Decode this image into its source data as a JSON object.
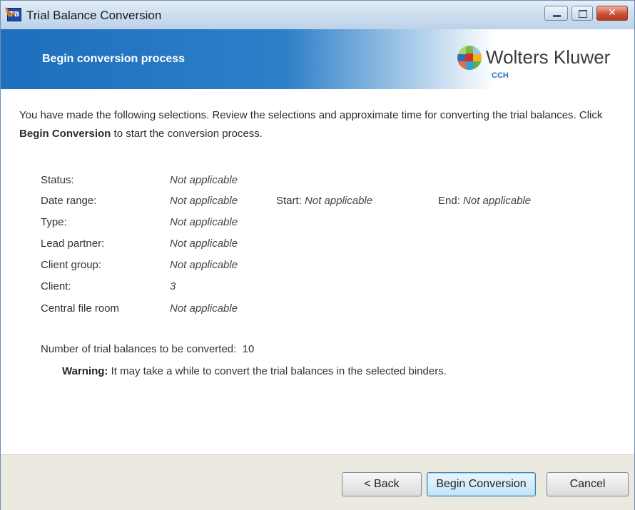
{
  "window": {
    "title": "Trial Balance Conversion",
    "app_icon_text": "TB",
    "close_glyph": "✕",
    "icons": [
      "minimize-icon",
      "maximize-icon",
      "close-icon"
    ]
  },
  "banner": {
    "title": "Begin conversion process",
    "logo_name": "Wolters Kluwer",
    "logo_sub": "CCH",
    "colors": {
      "banner_blue": "#1d6fbd",
      "logo_green": "#7bbd3a",
      "logo_red": "#d32f2f",
      "logo_blue": "#2a72b8",
      "logo_yellow": "#f2b51d"
    }
  },
  "intro": {
    "line1_text": "You have made the following selections.  Review the selections and approximate time for converting the trial balances.  Click ",
    "bold_text": "Begin Conversion",
    "line2_text": " to start the conversion process."
  },
  "selections": [
    {
      "label": "Status:",
      "value": "Not applicable"
    },
    {
      "label": "Date range:",
      "value": "Not applicable",
      "start_label": "Start:",
      "start_value": "Not applicable",
      "end_label": "End:",
      "end_value": "Not applicable"
    },
    {
      "label": "Type:",
      "value": "Not applicable"
    },
    {
      "label": "Lead partner:",
      "value": "Not applicable"
    },
    {
      "label": "Client group:",
      "value": "Not applicable"
    },
    {
      "label": "Client:",
      "value": "3"
    },
    {
      "label": "Central file room",
      "value": "Not applicable"
    }
  ],
  "summary": {
    "count_label": "Number of trial balances to be converted:",
    "count_value": "10",
    "warning_label": "Warning:",
    "warning_text": "It may take a while to convert the trial balances in the selected binders."
  },
  "buttons": {
    "back": "< Back",
    "begin": "Begin Conversion",
    "cancel": "Cancel"
  }
}
